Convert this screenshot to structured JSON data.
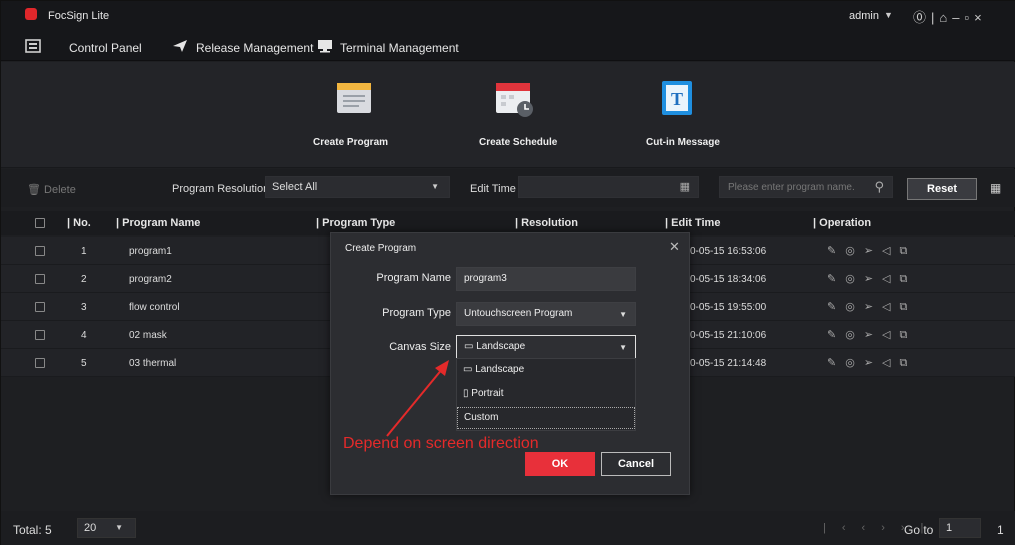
{
  "app": {
    "name": "FocSign Lite",
    "user": "admin"
  },
  "menu": [
    {
      "label": "Control Panel",
      "icon": "control-panel-icon"
    },
    {
      "label": "Release Management",
      "icon": "send-icon"
    },
    {
      "label": "Terminal Management",
      "icon": "monitor-icon"
    }
  ],
  "actions": [
    {
      "label": "Create Program",
      "icon": "create-program-icon"
    },
    {
      "label": "Create Schedule",
      "icon": "calendar-icon"
    },
    {
      "label": "Cut-in Message",
      "icon": "text-message-icon"
    }
  ],
  "filters": {
    "delete_label": "Delete",
    "resolution_label": "Program Resolution",
    "resolution_value": "Select All",
    "edit_time_label": "Edit Time",
    "search_placeholder": "Please enter program name.",
    "reset_label": "Reset"
  },
  "table": {
    "columns": [
      "No.",
      "Program Name",
      "Program Type",
      "Resolution",
      "Edit Time",
      "Operation"
    ],
    "rows": [
      {
        "no": "1",
        "name": "program1",
        "time": "0-05-15 16:53:06"
      },
      {
        "no": "2",
        "name": "program2",
        "time": "0-05-15 18:34:06"
      },
      {
        "no": "3",
        "name": "flow control",
        "time": "0-05-15 19:55:00"
      },
      {
        "no": "4",
        "name": "02 mask",
        "time": "0-05-15 21:10:06"
      },
      {
        "no": "5",
        "name": "03 thermal",
        "time": "0-05-15 21:14:48"
      }
    ]
  },
  "footer": {
    "total_label": "Total: 5",
    "page_size": "20",
    "goto_label": "Go to",
    "goto_value": "1",
    "current_page": "1"
  },
  "dialog": {
    "title": "Create Program",
    "name_label": "Program Name",
    "name_value": "program3",
    "type_label": "Program Type",
    "type_value": "Untouchscreen Program",
    "canvas_label": "Canvas Size",
    "canvas_value": "Landscape",
    "options": [
      "Landscape",
      "Portrait",
      "Custom"
    ],
    "ok_label": "OK",
    "cancel_label": "Cancel"
  },
  "annotation": "Depend on screen direction",
  "colors": {
    "accent": "#e8303a",
    "annotation": "#e42a2a",
    "background": "#1e1f22"
  }
}
